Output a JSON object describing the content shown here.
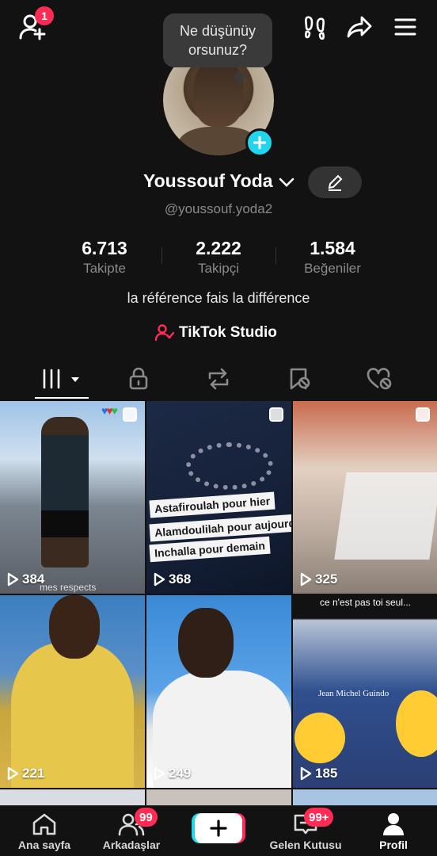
{
  "header": {
    "add_friend_badge": "1",
    "status_bubble": "Ne düşünüy orsunuz?"
  },
  "profile": {
    "name": "Youssouf Yoda",
    "username": "@youssouf.yoda2",
    "bio": "la référence fais la différence",
    "studio_label": "TikTok Studio",
    "stats": [
      {
        "value": "6.713",
        "label": "Takipte"
      },
      {
        "value": "2.222",
        "label": "Takipçi"
      },
      {
        "value": "1.584",
        "label": "Beğeniler"
      }
    ]
  },
  "tabs": [
    "videos-icon",
    "lock-icon",
    "repost-icon",
    "saved-icon",
    "liked-icon"
  ],
  "videos": [
    {
      "views": "384",
      "caption": "mes respects",
      "pinned": true
    },
    {
      "views": "368",
      "pinned": true,
      "lines": [
        "Astafiroulah pour hier",
        "Alamdoulilah pour aujourd'hui",
        "Inchalla pour demain"
      ]
    },
    {
      "views": "325",
      "pinned": true
    },
    {
      "views": "221"
    },
    {
      "views": "249"
    },
    {
      "views": "185",
      "caption": "ce n'est pas toi seul...",
      "overlay": "Jean Michel Guindo"
    }
  ],
  "bottom_nav": {
    "home": "Ana sayfa",
    "friends": "Arkadaşlar",
    "friends_badge": "99",
    "inbox": "Gelen Kutusu",
    "inbox_badge": "99+",
    "profile": "Profil"
  },
  "colors": {
    "background": "#121212",
    "accent_red": "#fe2c55",
    "accent_cyan": "#20d5ec",
    "muted_text": "#8a8a8a"
  }
}
